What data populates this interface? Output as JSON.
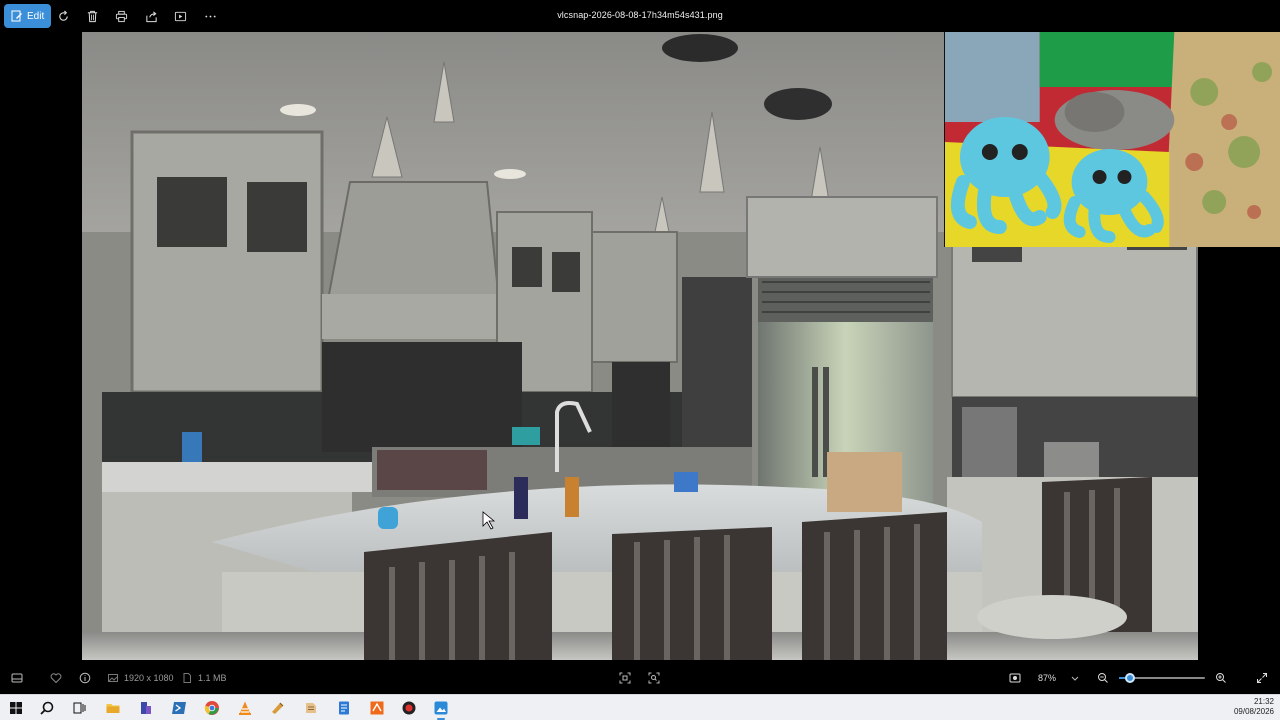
{
  "toolbar": {
    "edit_label": "Edit",
    "filename": "vlcsnap-2026-08-08-17h34m54s431.png",
    "icons": [
      "rotate-icon",
      "delete-icon",
      "print-icon",
      "share-icon",
      "slideshow-icon",
      "more-icon"
    ]
  },
  "image": {
    "description_icon": "kitchen-photo",
    "pip_icon": "octopus-plush-photo"
  },
  "statusbar": {
    "resolution": "1920 x 1080",
    "file_size": "1.1 MB",
    "zoom": "87%",
    "zoom_level": 0.13
  },
  "taskbar": {
    "apps": [
      "start-icon",
      "search-icon",
      "task-view-icon",
      "file-explorer-icon",
      "app-icon",
      "powershell-icon",
      "chrome-icon",
      "vlc-icon",
      "app-icon",
      "app-icon",
      "notepad-icon",
      "app-icon",
      "app-icon",
      "photos-icon"
    ],
    "time": "21:32",
    "date": "09/08/2026"
  },
  "colors": {
    "accent": "#3b8fd8",
    "toolbar_bg": "#000000",
    "taskbar_bg": "#eef0f3"
  }
}
